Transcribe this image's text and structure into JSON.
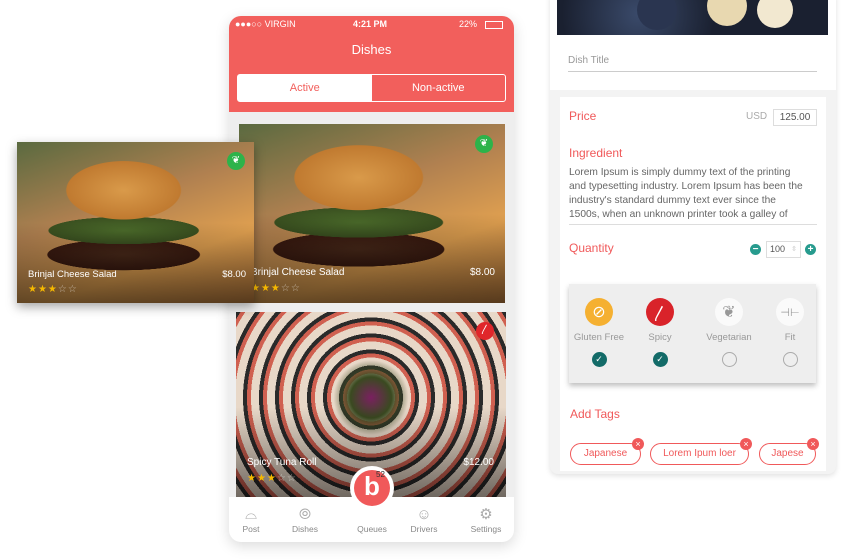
{
  "colors": {
    "accent": "#f25f5c",
    "teal": "#279b8e",
    "check": "#136b68"
  },
  "editor": {
    "dish_title_placeholder": "Dish Title",
    "price_label": "Price",
    "currency": "USD",
    "price_value": "125.00",
    "ingredient_label": "Ingredient",
    "ingredient_text": "Lorem Ipsum is simply dummy text of the printing and typesetting industry. Lorem Ipsum has been the industry's standard dummy text ever since the 1500s, when an unknown printer took a galley of",
    "quantity_label": "Quantity",
    "quantity_value": "100",
    "options": [
      {
        "label": "Gluten Free",
        "icon": "wheat-off-icon",
        "checked": true
      },
      {
        "label": "Spicy",
        "icon": "chili-icon",
        "checked": true
      },
      {
        "label": "Vegetarian",
        "icon": "leaf-icon",
        "checked": false
      },
      {
        "label": "Fit",
        "icon": "dumbbell-icon",
        "checked": false
      }
    ],
    "add_tags_label": "Add Tags",
    "tags": [
      "Japanese",
      "Lorem Ipum loer",
      "Japese"
    ]
  },
  "phone": {
    "status": {
      "carrier": "●●●○○ VIRGIN",
      "time": "4:21 PM",
      "battery": "22%"
    },
    "title": "Dishes",
    "tabs": {
      "active": "Active",
      "inactive": "Non-active"
    },
    "dishes": [
      {
        "name": "Brinjal Cheese Salad",
        "price": "$8.00",
        "rating": 3,
        "badge": "leaf-icon"
      },
      {
        "name": "Spicy Tuna Roll",
        "price": "$12.00",
        "rating": 3,
        "badge": "chili-icon"
      }
    ],
    "nav": [
      {
        "label": "Post",
        "icon": "cloche-icon"
      },
      {
        "label": "Dishes",
        "icon": "plate-cutlery-icon"
      },
      {
        "label": "Queues",
        "icon": "queues-logo-icon",
        "count": "52"
      },
      {
        "label": "Drivers",
        "icon": "driver-icon"
      },
      {
        "label": "Settings",
        "icon": "gear-icon"
      }
    ]
  },
  "floating_card": {
    "name": "Brinjal Cheese Salad",
    "price": "$8.00",
    "rating": 3
  }
}
